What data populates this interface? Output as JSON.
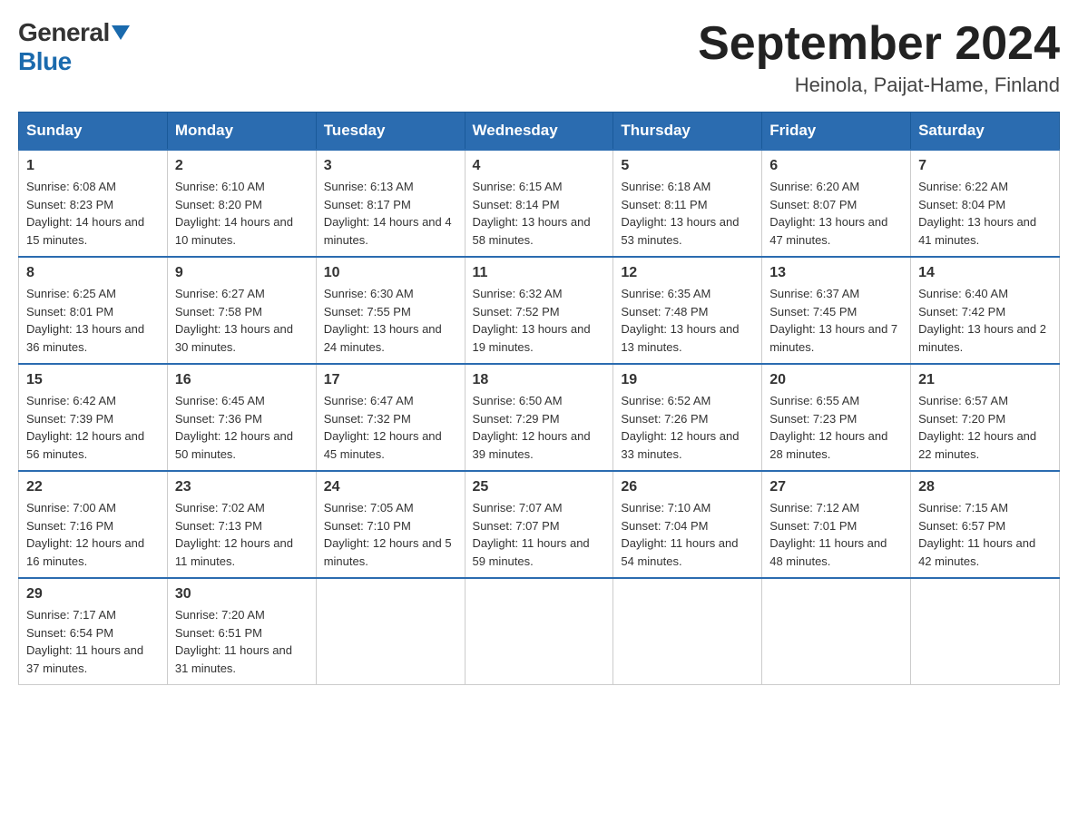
{
  "logo": {
    "general": "General",
    "blue": "Blue"
  },
  "title": {
    "month_year": "September 2024",
    "location": "Heinola, Paijat-Hame, Finland"
  },
  "headers": [
    "Sunday",
    "Monday",
    "Tuesday",
    "Wednesday",
    "Thursday",
    "Friday",
    "Saturday"
  ],
  "weeks": [
    [
      {
        "day": "1",
        "sunrise": "Sunrise: 6:08 AM",
        "sunset": "Sunset: 8:23 PM",
        "daylight": "Daylight: 14 hours and 15 minutes."
      },
      {
        "day": "2",
        "sunrise": "Sunrise: 6:10 AM",
        "sunset": "Sunset: 8:20 PM",
        "daylight": "Daylight: 14 hours and 10 minutes."
      },
      {
        "day": "3",
        "sunrise": "Sunrise: 6:13 AM",
        "sunset": "Sunset: 8:17 PM",
        "daylight": "Daylight: 14 hours and 4 minutes."
      },
      {
        "day": "4",
        "sunrise": "Sunrise: 6:15 AM",
        "sunset": "Sunset: 8:14 PM",
        "daylight": "Daylight: 13 hours and 58 minutes."
      },
      {
        "day": "5",
        "sunrise": "Sunrise: 6:18 AM",
        "sunset": "Sunset: 8:11 PM",
        "daylight": "Daylight: 13 hours and 53 minutes."
      },
      {
        "day": "6",
        "sunrise": "Sunrise: 6:20 AM",
        "sunset": "Sunset: 8:07 PM",
        "daylight": "Daylight: 13 hours and 47 minutes."
      },
      {
        "day": "7",
        "sunrise": "Sunrise: 6:22 AM",
        "sunset": "Sunset: 8:04 PM",
        "daylight": "Daylight: 13 hours and 41 minutes."
      }
    ],
    [
      {
        "day": "8",
        "sunrise": "Sunrise: 6:25 AM",
        "sunset": "Sunset: 8:01 PM",
        "daylight": "Daylight: 13 hours and 36 minutes."
      },
      {
        "day": "9",
        "sunrise": "Sunrise: 6:27 AM",
        "sunset": "Sunset: 7:58 PM",
        "daylight": "Daylight: 13 hours and 30 minutes."
      },
      {
        "day": "10",
        "sunrise": "Sunrise: 6:30 AM",
        "sunset": "Sunset: 7:55 PM",
        "daylight": "Daylight: 13 hours and 24 minutes."
      },
      {
        "day": "11",
        "sunrise": "Sunrise: 6:32 AM",
        "sunset": "Sunset: 7:52 PM",
        "daylight": "Daylight: 13 hours and 19 minutes."
      },
      {
        "day": "12",
        "sunrise": "Sunrise: 6:35 AM",
        "sunset": "Sunset: 7:48 PM",
        "daylight": "Daylight: 13 hours and 13 minutes."
      },
      {
        "day": "13",
        "sunrise": "Sunrise: 6:37 AM",
        "sunset": "Sunset: 7:45 PM",
        "daylight": "Daylight: 13 hours and 7 minutes."
      },
      {
        "day": "14",
        "sunrise": "Sunrise: 6:40 AM",
        "sunset": "Sunset: 7:42 PM",
        "daylight": "Daylight: 13 hours and 2 minutes."
      }
    ],
    [
      {
        "day": "15",
        "sunrise": "Sunrise: 6:42 AM",
        "sunset": "Sunset: 7:39 PM",
        "daylight": "Daylight: 12 hours and 56 minutes."
      },
      {
        "day": "16",
        "sunrise": "Sunrise: 6:45 AM",
        "sunset": "Sunset: 7:36 PM",
        "daylight": "Daylight: 12 hours and 50 minutes."
      },
      {
        "day": "17",
        "sunrise": "Sunrise: 6:47 AM",
        "sunset": "Sunset: 7:32 PM",
        "daylight": "Daylight: 12 hours and 45 minutes."
      },
      {
        "day": "18",
        "sunrise": "Sunrise: 6:50 AM",
        "sunset": "Sunset: 7:29 PM",
        "daylight": "Daylight: 12 hours and 39 minutes."
      },
      {
        "day": "19",
        "sunrise": "Sunrise: 6:52 AM",
        "sunset": "Sunset: 7:26 PM",
        "daylight": "Daylight: 12 hours and 33 minutes."
      },
      {
        "day": "20",
        "sunrise": "Sunrise: 6:55 AM",
        "sunset": "Sunset: 7:23 PM",
        "daylight": "Daylight: 12 hours and 28 minutes."
      },
      {
        "day": "21",
        "sunrise": "Sunrise: 6:57 AM",
        "sunset": "Sunset: 7:20 PM",
        "daylight": "Daylight: 12 hours and 22 minutes."
      }
    ],
    [
      {
        "day": "22",
        "sunrise": "Sunrise: 7:00 AM",
        "sunset": "Sunset: 7:16 PM",
        "daylight": "Daylight: 12 hours and 16 minutes."
      },
      {
        "day": "23",
        "sunrise": "Sunrise: 7:02 AM",
        "sunset": "Sunset: 7:13 PM",
        "daylight": "Daylight: 12 hours and 11 minutes."
      },
      {
        "day": "24",
        "sunrise": "Sunrise: 7:05 AM",
        "sunset": "Sunset: 7:10 PM",
        "daylight": "Daylight: 12 hours and 5 minutes."
      },
      {
        "day": "25",
        "sunrise": "Sunrise: 7:07 AM",
        "sunset": "Sunset: 7:07 PM",
        "daylight": "Daylight: 11 hours and 59 minutes."
      },
      {
        "day": "26",
        "sunrise": "Sunrise: 7:10 AM",
        "sunset": "Sunset: 7:04 PM",
        "daylight": "Daylight: 11 hours and 54 minutes."
      },
      {
        "day": "27",
        "sunrise": "Sunrise: 7:12 AM",
        "sunset": "Sunset: 7:01 PM",
        "daylight": "Daylight: 11 hours and 48 minutes."
      },
      {
        "day": "28",
        "sunrise": "Sunrise: 7:15 AM",
        "sunset": "Sunset: 6:57 PM",
        "daylight": "Daylight: 11 hours and 42 minutes."
      }
    ],
    [
      {
        "day": "29",
        "sunrise": "Sunrise: 7:17 AM",
        "sunset": "Sunset: 6:54 PM",
        "daylight": "Daylight: 11 hours and 37 minutes."
      },
      {
        "day": "30",
        "sunrise": "Sunrise: 7:20 AM",
        "sunset": "Sunset: 6:51 PM",
        "daylight": "Daylight: 11 hours and 31 minutes."
      },
      null,
      null,
      null,
      null,
      null
    ]
  ]
}
